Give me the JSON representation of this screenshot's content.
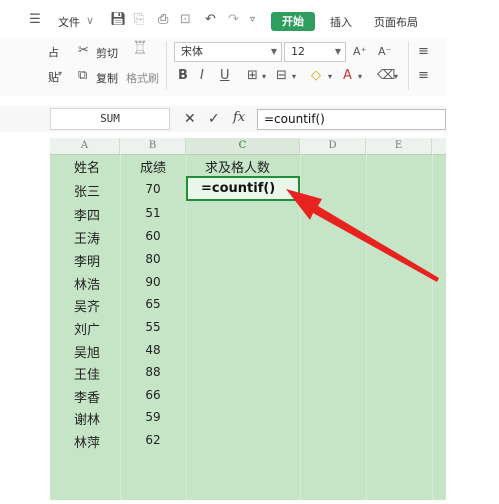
{
  "ribbon_tabs": {
    "file": "文件",
    "start": "开始",
    "insert": "插入",
    "page_layout": "页面布局",
    "dropdown_caret": "∨"
  },
  "toolbar": {
    "cut": "剪切",
    "copy": "复制",
    "format_painter": "格式刷",
    "paste_fragment_top": "占",
    "paste_fragment_bottom": "贴"
  },
  "font": {
    "name": "宋体",
    "size": "12"
  },
  "formula_bar": {
    "name_box": "SUM",
    "cancel_glyph": "✕",
    "confirm_glyph": "✓",
    "fx": "fx",
    "formula": "=countif()"
  },
  "columns": [
    "A",
    "B",
    "C",
    "D",
    "E"
  ],
  "headers": {
    "name": "姓名",
    "score": "成绩",
    "count": "求及格人数"
  },
  "rows": [
    {
      "name": "张三",
      "score": "70"
    },
    {
      "name": "李四",
      "score": "51"
    },
    {
      "name": "王涛",
      "score": "60"
    },
    {
      "name": "李明",
      "score": "80"
    },
    {
      "name": "林浩",
      "score": "90"
    },
    {
      "name": "吴齐",
      "score": "65"
    },
    {
      "name": "刘广",
      "score": "55"
    },
    {
      "name": "吴旭",
      "score": "48"
    },
    {
      "name": "王佳",
      "score": "88"
    },
    {
      "name": "李香",
      "score": "66"
    },
    {
      "name": "谢林",
      "score": "59"
    },
    {
      "name": "林萍",
      "score": "62"
    }
  ],
  "active_cell_text": "=countif()",
  "colors": {
    "sheet_bg": "#c6e5c6",
    "accent_green": "#2e9d5e",
    "arrow_red": "#e8231f"
  }
}
